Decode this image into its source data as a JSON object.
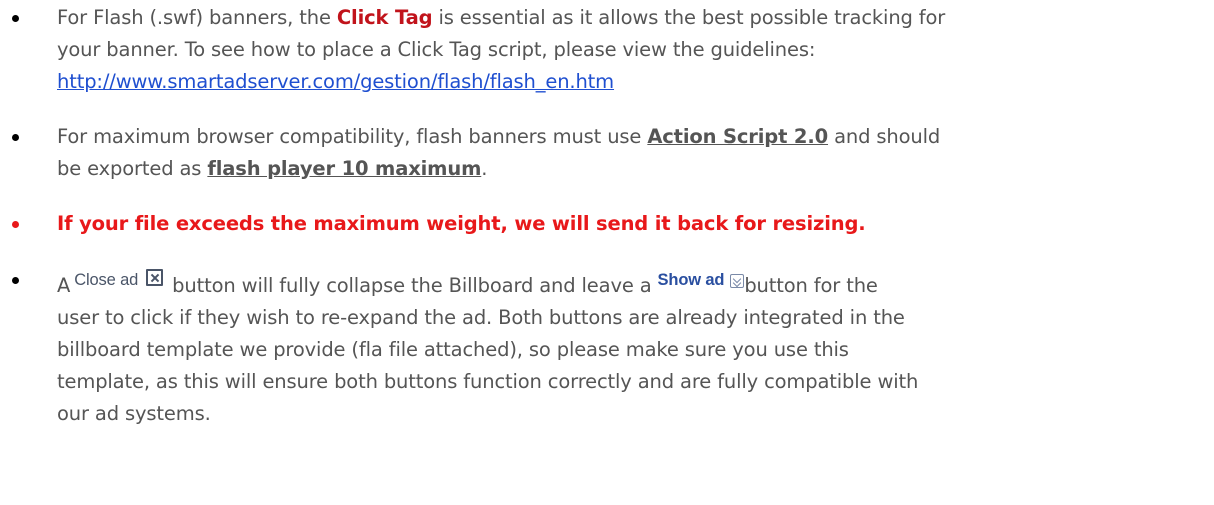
{
  "colors": {
    "body_text": "#555555",
    "keyword_red": "#c1131b",
    "warning_red": "#e8181a",
    "link_blue": "#1f4fd0",
    "show_ad_blue": "#2a4fa0"
  },
  "bullets": [
    {
      "l1_a": "For Flash (.swf) banners, the ",
      "l1_kw": "Click Tag",
      "l1_b": " is essential as it allows the best possible tracking for",
      "l2": "your banner. To see how to place a Click Tag script, please view the guidelines:",
      "link": "http://www.smartadserver.com/gestion/flash/flash_en.htm"
    },
    {
      "l1_a": "For maximum browser compatibility, flash banners must use ",
      "l1_kw": "Action Script 2.0",
      "l1_b": " and should",
      "l2_a": "be exported as ",
      "l2_kw": "flash player 10 maximum",
      "l2_b": "."
    },
    {
      "text": "If your file exceeds the maximum weight, we will send it back for resizing."
    },
    {
      "l1_a": "A",
      "close_label": "Close ad",
      "l1_b": " button will fully collapse the Billboard and leave a",
      "show_label": "Show ad",
      "l1_c": "button for the",
      "l2": "user to click if they wish to re-expand the ad. Both buttons are already integrated in the",
      "l3": "billboard template we provide (fla file attached), so please make sure you use this",
      "l4": "template, as this will ensure both buttons function correctly and are fully compatible with",
      "l5": "our ad systems."
    }
  ]
}
